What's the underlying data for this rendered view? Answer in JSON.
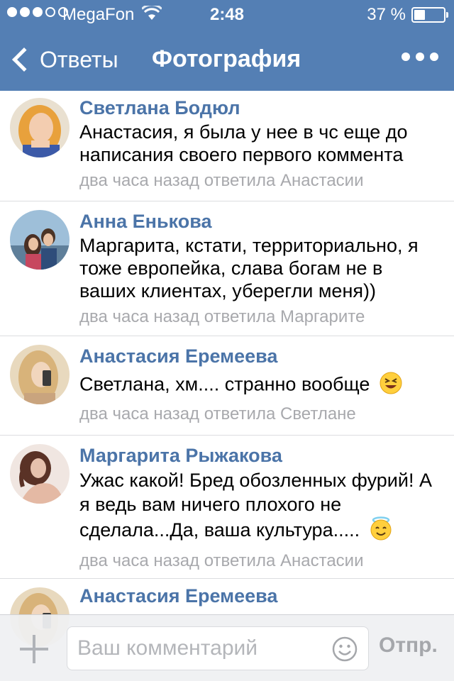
{
  "status_bar": {
    "carrier": "MegaFon",
    "time": "2:48",
    "battery_percent_text": "37 %",
    "battery_level": 0.37,
    "signal_bars_filled": 3,
    "signal_bars_total": 5
  },
  "nav": {
    "back_label": "Ответы",
    "title": "Фотография",
    "more_icon": "more-dots-icon"
  },
  "comments": [
    {
      "author": "Светлана Бодюл",
      "text": "Анастасия, я была у нее в чс еще до написания своего первого коммента",
      "meta": "два часа назад ответила Анастасии"
    },
    {
      "author": "Анна Енькова",
      "text": "Маргарита, кстати, территориально, я тоже европейка, слава богам не в ваших клиентах, уберегли меня))",
      "meta": "два часа назад ответила Маргарите"
    },
    {
      "author": "Анастасия Еремеева",
      "text": "Светлана, хм.... странно вообще",
      "emoji": "laughing-emoji",
      "meta": "два часа назад ответила Светлане"
    },
    {
      "author": "Маргарита Рыжакова",
      "text": "Ужас какой! Бред обозленных фурий! А я ведь вам ничего плохого не сделала...Да, ваша культура.....",
      "emoji": "halo-emoji",
      "meta": "два часа назад ответила Анастасии"
    },
    {
      "author": "Анастасия Еремеева"
    }
  ],
  "composer": {
    "placeholder": "Ваш комментарий",
    "send_label": "Отпр.",
    "attach_icon": "plus-icon",
    "emoji_icon": "smiley-icon"
  },
  "colors": {
    "header": "#547fb4",
    "author": "#4b74a8",
    "meta": "#a8a9ad"
  }
}
